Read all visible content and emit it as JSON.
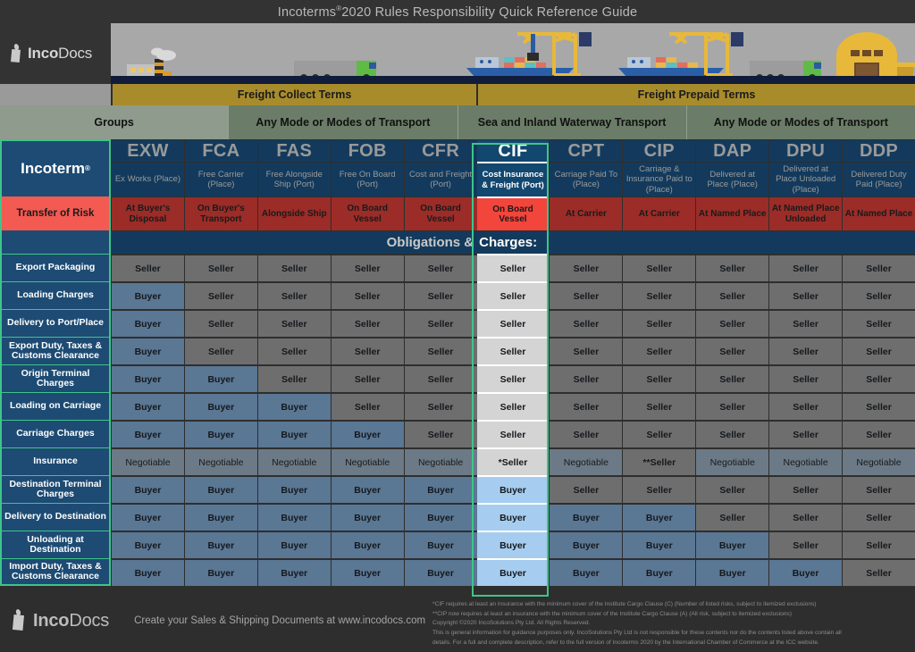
{
  "title": {
    "main": "Incoterms",
    "registered": "®",
    "rest": "2020 Rules Responsibility Quick Reference Guide"
  },
  "brand": {
    "name_bold": "Inco",
    "name_thin": "Docs"
  },
  "freight_groups": [
    {
      "label": "Freight Collect Terms",
      "span": 5
    },
    {
      "label": "Freight Prepaid Terms",
      "span": 6
    }
  ],
  "mode_row": {
    "groups_label": "Groups",
    "modes": [
      {
        "label": "Any Mode or Modes of Transport",
        "span": 2
      },
      {
        "label": "Sea and Inland Waterway Transport",
        "span": 3
      },
      {
        "label": "Any Mode or Modes of Transport",
        "span": 6
      }
    ]
  },
  "row_labels": {
    "incoterm": "Incoterm",
    "incoterm_mark": "®",
    "transfer_of_risk": "Transfer of Risk",
    "obligations": "Obligations &",
    "obligations_hl": "Charges:"
  },
  "terms": [
    {
      "code": "EXW",
      "name": "Ex Works (Place)",
      "risk": "At Buyer's Disposal",
      "highlight": false
    },
    {
      "code": "FCA",
      "name": "Free Carrier (Place)",
      "risk": "On Buyer's Transport",
      "highlight": false
    },
    {
      "code": "FAS",
      "name": "Free Alongside Ship (Port)",
      "risk": "Alongside Ship",
      "highlight": false
    },
    {
      "code": "FOB",
      "name": "Free On Board (Port)",
      "risk": "On Board Vessel",
      "highlight": false
    },
    {
      "code": "CFR",
      "name": "Cost and Freight (Port)",
      "risk": "On Board Vessel",
      "highlight": false
    },
    {
      "code": "CIF",
      "name": "Cost Insurance & Freight (Port)",
      "risk": "On Board Vessel",
      "highlight": true
    },
    {
      "code": "CPT",
      "name": "Carriage Paid To (Place)",
      "risk": "At Carrier",
      "highlight": false
    },
    {
      "code": "CIP",
      "name": "Carriage & Insurance Paid to (Place)",
      "risk": "At Carrier",
      "highlight": false
    },
    {
      "code": "DAP",
      "name": "Delivered at Place (Place)",
      "risk": "At Named Place",
      "highlight": false
    },
    {
      "code": "DPU",
      "name": "Delivered at Place Unloaded (Place)",
      "risk": "At Named Place Unloaded",
      "highlight": false
    },
    {
      "code": "DDP",
      "name": "Delivered Duty Paid (Place)",
      "risk": "At Named Place",
      "highlight": false
    }
  ],
  "chart_data": {
    "type": "table",
    "title": "Incoterms 2020 Rules Responsibility Quick Reference Guide",
    "columns": [
      "EXW",
      "FCA",
      "FAS",
      "FOB",
      "CFR",
      "CIF",
      "CPT",
      "CIP",
      "DAP",
      "DPU",
      "DDP"
    ],
    "highlight_column": "CIF",
    "legend": {
      "Seller": "#6e6e6e",
      "Buyer": "#5a7794",
      "Negotiable": "#6b7a86"
    },
    "rows": [
      {
        "label": "Export Packaging",
        "values": [
          "Seller",
          "Seller",
          "Seller",
          "Seller",
          "Seller",
          "Seller",
          "Seller",
          "Seller",
          "Seller",
          "Seller",
          "Seller"
        ]
      },
      {
        "label": "Loading Charges",
        "values": [
          "Buyer",
          "Seller",
          "Seller",
          "Seller",
          "Seller",
          "Seller",
          "Seller",
          "Seller",
          "Seller",
          "Seller",
          "Seller"
        ]
      },
      {
        "label": "Delivery to Port/Place",
        "values": [
          "Buyer",
          "Seller",
          "Seller",
          "Seller",
          "Seller",
          "Seller",
          "Seller",
          "Seller",
          "Seller",
          "Seller",
          "Seller"
        ]
      },
      {
        "label": "Export Duty, Taxes & Customs Clearance",
        "values": [
          "Buyer",
          "Seller",
          "Seller",
          "Seller",
          "Seller",
          "Seller",
          "Seller",
          "Seller",
          "Seller",
          "Seller",
          "Seller"
        ]
      },
      {
        "label": "Origin Terminal Charges",
        "values": [
          "Buyer",
          "Buyer",
          "Seller",
          "Seller",
          "Seller",
          "Seller",
          "Seller",
          "Seller",
          "Seller",
          "Seller",
          "Seller"
        ]
      },
      {
        "label": "Loading on Carriage",
        "values": [
          "Buyer",
          "Buyer",
          "Buyer",
          "Seller",
          "Seller",
          "Seller",
          "Seller",
          "Seller",
          "Seller",
          "Seller",
          "Seller"
        ]
      },
      {
        "label": "Carriage Charges",
        "values": [
          "Buyer",
          "Buyer",
          "Buyer",
          "Buyer",
          "Seller",
          "Seller",
          "Seller",
          "Seller",
          "Seller",
          "Seller",
          "Seller"
        ]
      },
      {
        "label": "Insurance",
        "values": [
          "Negotiable",
          "Negotiable",
          "Negotiable",
          "Negotiable",
          "Negotiable",
          "*Seller",
          "Negotiable",
          "**Seller",
          "Negotiable",
          "Negotiable",
          "Negotiable"
        ]
      },
      {
        "label": "Destination Terminal Charges",
        "values": [
          "Buyer",
          "Buyer",
          "Buyer",
          "Buyer",
          "Buyer",
          "Buyer",
          "Seller",
          "Seller",
          "Seller",
          "Seller",
          "Seller"
        ]
      },
      {
        "label": "Delivery to Destination",
        "values": [
          "Buyer",
          "Buyer",
          "Buyer",
          "Buyer",
          "Buyer",
          "Buyer",
          "Buyer",
          "Buyer",
          "Seller",
          "Seller",
          "Seller"
        ]
      },
      {
        "label": "Unloading at Destination",
        "values": [
          "Buyer",
          "Buyer",
          "Buyer",
          "Buyer",
          "Buyer",
          "Buyer",
          "Buyer",
          "Buyer",
          "Buyer",
          "Seller",
          "Seller"
        ]
      },
      {
        "label": "Import Duty, Taxes & Customs Clearance",
        "values": [
          "Buyer",
          "Buyer",
          "Buyer",
          "Buyer",
          "Buyer",
          "Buyer",
          "Buyer",
          "Buyer",
          "Buyer",
          "Buyer",
          "Seller"
        ]
      }
    ]
  },
  "footer": {
    "tagline": "Create your Sales & Shipping Documents at www.incodocs.com",
    "notes": [
      "*CIF requires at least an insurance with the minimum cover of the Institute Cargo Clause (C) (Number of listed risks, subject to itemized exclusions)",
      "**CIP now requires at least an insurance with the minimum cover of the Institute Cargo Clause (A) (All risk, subject to itemized exclusions)",
      "Copyright ©2020 IncoSolutions Pty Ltd. All Rights Reserved.",
      "This is general information for guidance purposes only.  IncoSolutions Pty Ltd is not responsible for these contents nor do the contents listed above contain all",
      "details.  For a full and complete description, refer to the full version of Incoterms   2020 by the International Chamber of Commerce at the ICC website."
    ]
  }
}
